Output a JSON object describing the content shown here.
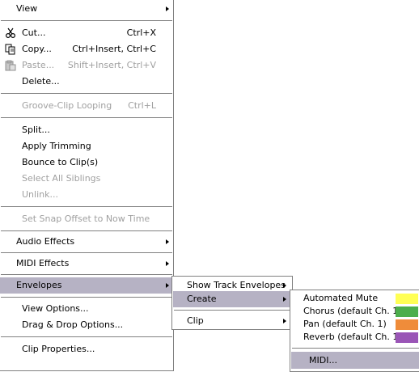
{
  "main_menu": {
    "items": [
      {
        "label": "View",
        "has_submenu": true
      },
      {
        "label": "Cut...",
        "shortcut": "Ctrl+X",
        "icon": "scissors-icon"
      },
      {
        "label": "Copy...",
        "shortcut": "Ctrl+Insert, Ctrl+C",
        "icon": "copy-icon"
      },
      {
        "label": "Paste...",
        "shortcut": "Shift+Insert, Ctrl+V",
        "icon": "paste-icon",
        "disabled": true
      },
      {
        "label": "Delete..."
      },
      {
        "label": "Groove-Clip Looping",
        "shortcut": "Ctrl+L",
        "disabled": true
      },
      {
        "label": "Split..."
      },
      {
        "label": "Apply Trimming"
      },
      {
        "label": "Bounce to Clip(s)"
      },
      {
        "label": "Select All Siblings",
        "disabled": true
      },
      {
        "label": "Unlink...",
        "disabled": true
      },
      {
        "label": "Set Snap Offset to Now Time",
        "disabled": true
      },
      {
        "label": "Audio Effects",
        "has_submenu": true
      },
      {
        "label": "MIDI Effects",
        "has_submenu": true
      },
      {
        "label": "Envelopes",
        "has_submenu": true,
        "highlighted": true
      },
      {
        "label": "View Options..."
      },
      {
        "label": "Drag & Drop Options..."
      },
      {
        "label": "Clip Properties..."
      }
    ]
  },
  "envelopes_submenu": {
    "items": [
      {
        "label": "Show Track Envelopes",
        "has_submenu": true
      },
      {
        "label": "Create",
        "has_submenu": true,
        "highlighted": true
      },
      {
        "label": "Clip",
        "has_submenu": true
      }
    ]
  },
  "create_submenu": {
    "items": [
      {
        "label": "Automated Mute",
        "color": "#ffff55"
      },
      {
        "label": "Chorus (default Ch. 1)",
        "color": "#4cae4c"
      },
      {
        "label": "Pan (default Ch. 1)",
        "color": "#ef8c3a"
      },
      {
        "label": "Reverb (default Ch. 1)",
        "color": "#9a55b6"
      },
      {
        "label": "MIDI...",
        "highlighted": true
      }
    ]
  },
  "colors": {
    "highlight": "#b6b2c4",
    "disabled_text": "#a0a0a0",
    "border": "#808080"
  }
}
